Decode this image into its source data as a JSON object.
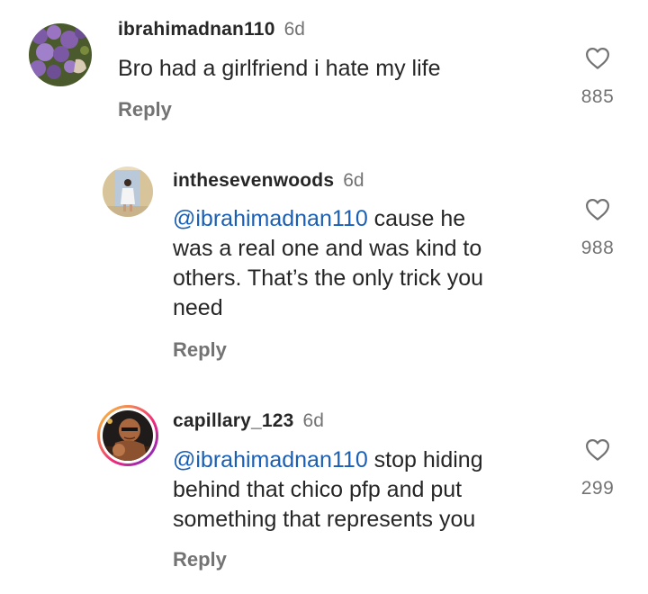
{
  "colors": {
    "text": "#262626",
    "muted": "#737373",
    "mention": "#1a5fb4",
    "story_ring_start": "#f9ce34",
    "story_ring_end": "#ee2a7b"
  },
  "comments": [
    {
      "username": "ibrahimadnan110",
      "time": "6d",
      "mention": "",
      "text": "Bro had a girlfriend i hate my life",
      "reply_label": "Reply",
      "likes": "885",
      "avatar_icon": "lavender-flowers-avatar"
    },
    {
      "username": "inthesevenwoods",
      "time": "6d",
      "mention": "@ibrahimadnan110",
      "text_lines": [
        " cause he",
        "was a real one and was kind to",
        "others. That’s the only trick you",
        "need"
      ],
      "reply_label": "Reply",
      "likes": "988",
      "avatar_icon": "person-in-doorway-avatar"
    },
    {
      "username": "capillary_123",
      "time": "6d",
      "mention": "@ibrahimadnan110",
      "text_lines": [
        " stop hiding",
        "behind that chico pfp and put",
        "something that represents you"
      ],
      "reply_label": "Reply",
      "likes": "299",
      "avatar_icon": "bald-fighter-avatar",
      "has_story_ring": true
    }
  ]
}
